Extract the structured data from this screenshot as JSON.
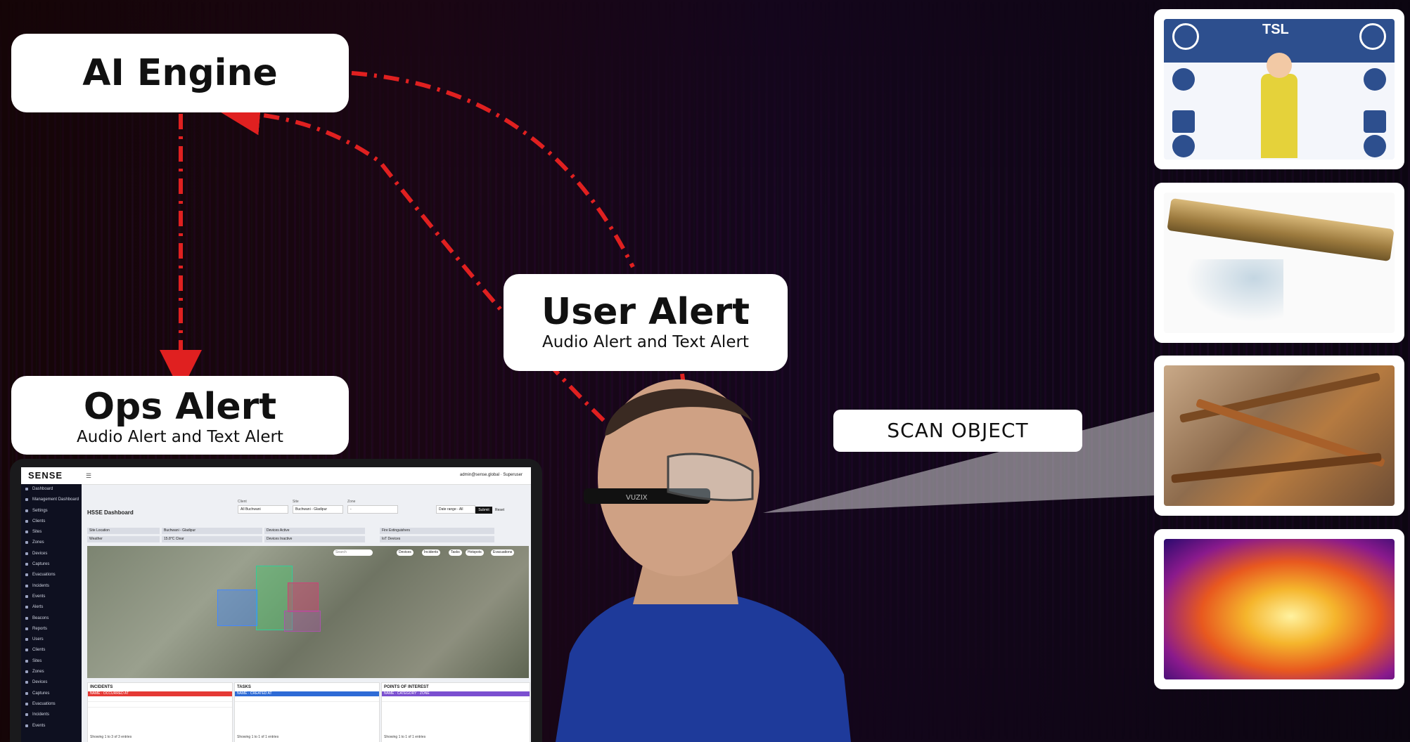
{
  "cards": {
    "ai_engine": {
      "title": "AI Engine"
    },
    "ops_alert": {
      "title": "Ops Alert",
      "subtitle": "Audio Alert and Text Alert"
    },
    "user_alert": {
      "title": "User Alert",
      "subtitle": "Audio Alert and Text Alert"
    },
    "scan_object": {
      "label": "SCAN OBJECT"
    }
  },
  "colors": {
    "arrow": "#e02020",
    "card": "#ffffff"
  },
  "dashboard": {
    "logo": "SENSE",
    "user_email": "admin@sense.global · Superuser",
    "title": "HSSE Dashboard",
    "filters": {
      "client_label": "Client",
      "client_value": "All Buchwani",
      "site_label": "Site",
      "site_value": "Buchwani - Gladipur",
      "zone_label": "Zone",
      "zone_value": "-",
      "date_value": "Date range - All",
      "submit": "Submit",
      "reset": "Reset"
    },
    "info": {
      "site_location": "Site Location",
      "site_location_value": "Buchwani - Gladipur",
      "weather": "Weather",
      "weather_value": "15.8°C Clear",
      "devices_active": "Devices Active",
      "devices_inactive": "Devices Inactive",
      "fire_ext": "Fire Extinguishers",
      "iot_devices": "IoT Devices"
    },
    "map_tags": [
      "Devices",
      "Incidents",
      "Tasks",
      "Hotspots",
      "Evacuations"
    ],
    "map_search": "Search",
    "sidebar": [
      "Dashboard",
      "Management Dashboard",
      "Settings",
      "Clients",
      "Sites",
      "Zones",
      "Devices",
      "Captures",
      "Evacuations",
      "Incidents",
      "Events",
      "Alerts",
      "Beacons",
      "Reports",
      "Users",
      "Clients",
      "Sites",
      "Zones",
      "Devices",
      "Captures",
      "Evacuations",
      "Incidents",
      "Events"
    ],
    "panels": {
      "incidents": {
        "title": "INCIDENTS",
        "cols": "NAME · OCCURRED AT",
        "foot": "Showing 1 to 3 of 3 entries"
      },
      "tasks": {
        "title": "TASKS",
        "cols": "NAME · CREATED AT",
        "foot": "Showing 1 to 1 of 1 entries"
      },
      "poi": {
        "title": "POINTS OF INTEREST",
        "cols": "NAME · CATEGORY · ZONE",
        "foot": "Showing 1 to 1 of 1 entries"
      }
    }
  },
  "ppe_sign": {
    "brand": "TSL"
  },
  "glasses_brand": "VUZIX"
}
